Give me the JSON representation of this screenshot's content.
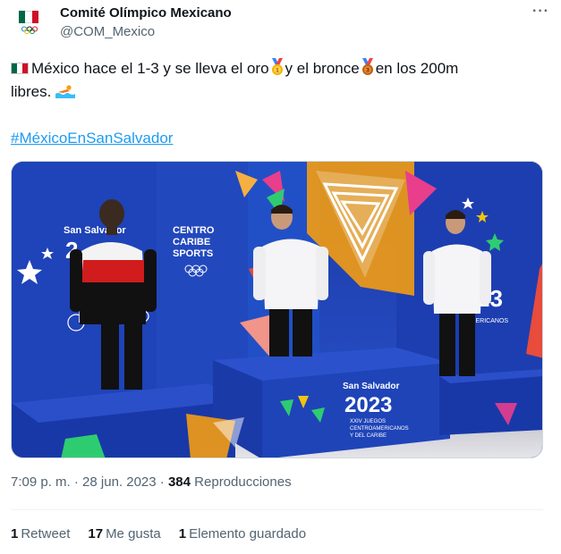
{
  "author": {
    "name": "Comité Olímpico Mexicano",
    "handle": "@COM_Mexico"
  },
  "tweet": {
    "line1_a": "México hace el 1-3 y se lleva el oro",
    "line1_b": "y el bronce",
    "line1_c": "en los 200m",
    "line2": "libres.",
    "hashtag": "#MéxicoEnSanSalvador"
  },
  "media": {
    "banner_city": "San Salvador",
    "banner_year": "2023",
    "sponsor_line1": "CENTRO",
    "sponsor_line2": "CARIBE",
    "sponsor_line3": "SPORTS",
    "podium_city": "San Salvador",
    "podium_year": "2023",
    "podium_sub1": "XXIV JUEGOS",
    "podium_sub2": "CENTROAMERICANOS",
    "podium_sub3": "Y DEL CARIBE",
    "right_year": "23",
    "right_sub": "AMERICANOS",
    "left_year_frag": "2"
  },
  "meta": {
    "time": "7:09 p. m.",
    "separator": "·",
    "date": "28 jun. 2023",
    "views_count": "384",
    "views_label": "Reproducciones"
  },
  "stats": [
    {
      "count": "1",
      "label": "Retweet"
    },
    {
      "count": "17",
      "label": "Me gusta"
    },
    {
      "count": "1",
      "label": "Elemento guardado"
    }
  ],
  "colors": {
    "link": "#1d9bf0",
    "secondary_text": "#536471",
    "podium_blue": "#1e3fb0",
    "mexico_green": "#006847",
    "mexico_red": "#ce1126"
  }
}
